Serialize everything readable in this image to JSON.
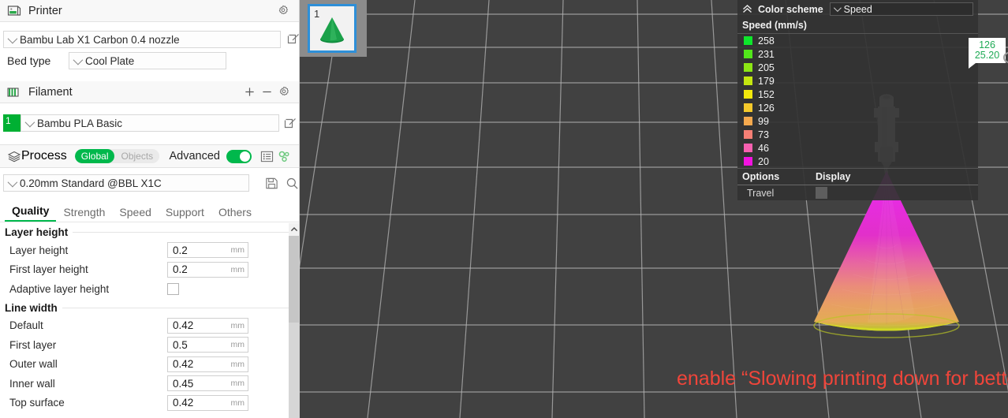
{
  "sidebar": {
    "printer": {
      "section_title": "Printer",
      "icon": "printer-icon",
      "settings_icon": "gear-icon",
      "preset": "Bambu Lab X1 Carbon 0.4 nozzle",
      "edit_icon": "edit-icon",
      "bed_type_label": "Bed type",
      "bed_type_value": "Cool Plate"
    },
    "filament": {
      "section_title": "Filament",
      "icon": "filament-icon",
      "add_icon": "plus-icon",
      "remove_icon": "minus-icon",
      "settings_icon": "gear-icon",
      "slot_number": "1",
      "slot_color": "#00b033",
      "preset": "Bambu PLA Basic",
      "edit_icon": "edit-icon"
    },
    "process": {
      "section_title": "Process",
      "icon": "layers-icon",
      "scope_global": "Global",
      "scope_objects": "Objects",
      "advanced_label": "Advanced",
      "advanced_on": true,
      "accent_color": "#00b84c",
      "list_icon": "list-icon",
      "compare_icon": "compare-gears-icon",
      "preset": "0.20mm Standard @BBL X1C",
      "save_icon": "save-icon",
      "search_icon": "search-icon"
    },
    "tabs": [
      {
        "label": "Quality",
        "active": true
      },
      {
        "label": "Strength",
        "active": false
      },
      {
        "label": "Speed",
        "active": false
      },
      {
        "label": "Support",
        "active": false
      },
      {
        "label": "Others",
        "active": false
      }
    ],
    "groups": [
      {
        "title": "Layer height",
        "rows": [
          {
            "name": "Layer height",
            "value": "0.2",
            "unit": "mm",
            "type": "field"
          },
          {
            "name": "First layer height",
            "value": "0.2",
            "unit": "mm",
            "type": "field"
          },
          {
            "name": "Adaptive layer height",
            "value": "",
            "unit": "",
            "type": "checkbox",
            "checked": false
          }
        ]
      },
      {
        "title": "Line width",
        "rows": [
          {
            "name": "Default",
            "value": "0.42",
            "unit": "mm",
            "type": "field"
          },
          {
            "name": "First layer",
            "value": "0.5",
            "unit": "mm",
            "type": "field"
          },
          {
            "name": "Outer wall",
            "value": "0.42",
            "unit": "mm",
            "type": "field"
          },
          {
            "name": "Inner wall",
            "value": "0.45",
            "unit": "mm",
            "type": "field"
          },
          {
            "name": "Top surface",
            "value": "0.42",
            "unit": "mm",
            "type": "field"
          }
        ]
      }
    ],
    "scrollbar": {
      "up_arrow_icon": "chevron-up-icon"
    }
  },
  "viewport": {
    "plate": {
      "number": "1",
      "model_icon": "cone-model-icon",
      "selected_color": "#2e8fd8"
    },
    "annotation": "enable “Slowing printing down for better layer cooling”",
    "annotation_color": "#f0453a",
    "nozzle_icon": "printer-nozzle-icon",
    "model_icon": "sliced-cone-icon",
    "tooltip": {
      "speed": "126",
      "height": "25.20",
      "text_color": "#1faa55"
    }
  },
  "legend": {
    "collapse_icon": "chevron-up-double-icon",
    "title": "Color scheme",
    "scheme_value": "Speed",
    "subtitle": "Speed (mm/s)",
    "entries": [
      {
        "value": "258",
        "color": "#0ee62b"
      },
      {
        "value": "231",
        "color": "#52e61b"
      },
      {
        "value": "205",
        "color": "#8ce614"
      },
      {
        "value": "179",
        "color": "#c4e610"
      },
      {
        "value": "152",
        "color": "#f2e80c"
      },
      {
        "value": "126",
        "color": "#f5c92b"
      },
      {
        "value": "99",
        "color": "#f5a94e"
      },
      {
        "value": "73",
        "color": "#f57f75"
      },
      {
        "value": "46",
        "color": "#f760b0"
      },
      {
        "value": "20",
        "color": "#f213e0"
      }
    ],
    "options_header": "Options",
    "display_header": "Display",
    "travel_label": "Travel",
    "travel_enabled": false
  }
}
